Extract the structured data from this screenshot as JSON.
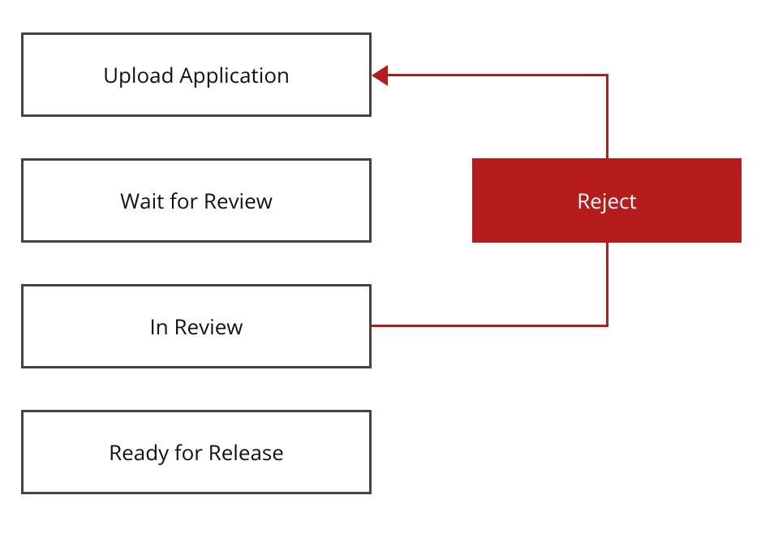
{
  "diagram": {
    "steps": [
      {
        "label": "Upload Application"
      },
      {
        "label": "Wait for Review"
      },
      {
        "label": "In Review"
      },
      {
        "label": "Ready for Release"
      }
    ],
    "decision": {
      "label": "Reject"
    },
    "colors": {
      "accent": "#B71C1C",
      "box_border": "#444444"
    }
  }
}
